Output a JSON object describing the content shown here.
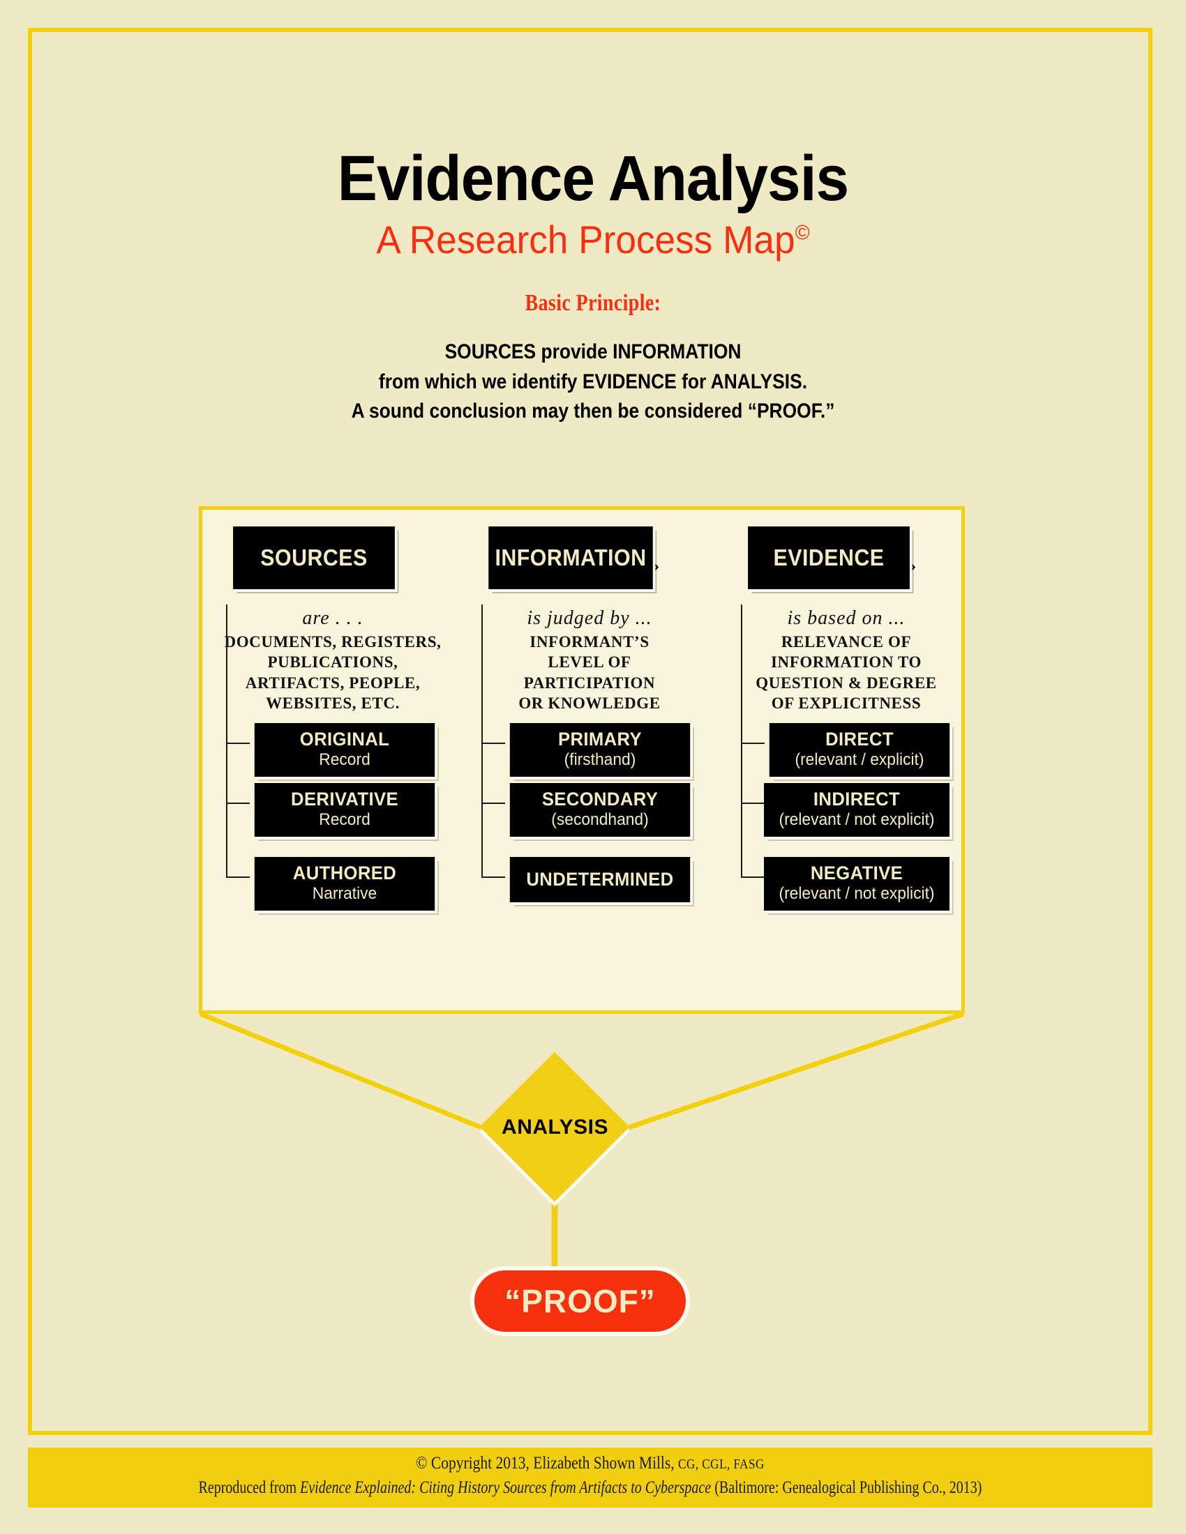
{
  "colors": {
    "page_background": "#efeac4",
    "border_yellow": "#f2d00d",
    "panel_background": "#f9f5dd",
    "accent_red": "#f72f10",
    "proof_red": "#f4300d",
    "box_black": "#000000",
    "box_text_cream": "#f2ecc4",
    "diamond_yellow": "#f2cf17",
    "footer_yellow": "#f2cf0e"
  },
  "header": {
    "title": "Evidence Analysis",
    "subtitle": "A Research Process Map",
    "subtitle_mark": "©",
    "basic_principle_label": "Basic Principle:",
    "principle_lines": [
      "SOURCES provide INFORMATION",
      "from which we identify EVIDENCE for ANALYSIS.",
      "A sound conclusion may then be considered “PROOF.”"
    ]
  },
  "diagram": {
    "arrow_glyph": "⇨",
    "columns": [
      {
        "id": "sources",
        "header": "SOURCES",
        "lead": "are . . .",
        "body_lines": [
          "DOCUMENTS,  REGISTERS,",
          "PUBLICATIONS,",
          "ARTIFACTS,  PEOPLE,",
          "WEBSITES,  ETC."
        ],
        "items": [
          {
            "title": "ORIGINAL",
            "subtitle": "Record"
          },
          {
            "title": "DERIVATIVE",
            "subtitle": "Record"
          },
          {
            "title": "AUTHORED",
            "subtitle": "Narrative"
          }
        ]
      },
      {
        "id": "information",
        "header": "INFORMATION",
        "lead": "is judged by ...",
        "body_lines": [
          "INFORMANT’S",
          "LEVEL OF",
          "PARTICIPATION",
          "OR KNOWLEDGE"
        ],
        "items": [
          {
            "title": "PRIMARY",
            "subtitle": "(firsthand)"
          },
          {
            "title": "SECONDARY",
            "subtitle": "(secondhand)"
          },
          {
            "title": "UNDETERMINED",
            "subtitle": ""
          }
        ]
      },
      {
        "id": "evidence",
        "header": "EVIDENCE",
        "lead": "is based on ...",
        "body_lines": [
          "RELEVANCE OF",
          "INFORMATION TO",
          "QUESTION & DEGREE",
          "OF EXPLICITNESS"
        ],
        "items": [
          {
            "title": "DIRECT",
            "subtitle": "(relevant / explicit)"
          },
          {
            "title": "INDIRECT",
            "subtitle": "(relevant / not explicit)"
          },
          {
            "title": "NEGATIVE",
            "subtitle": "(relevant / not explicit)"
          }
        ]
      }
    ]
  },
  "analysis": {
    "label": "ANALYSIS"
  },
  "proof": {
    "label": "“PROOF”"
  },
  "footer": {
    "line1_main": "© Copyright 2013, Elizabeth Shown Mills, ",
    "line1_credentials": "CG, CGL, FASG",
    "line2_prefix": "Reproduced from ",
    "line2_italic": "Evidence Explained: Citing History Sources from Artifacts to Cyberspace",
    "line2_suffix": " (Baltimore: Genealogical Publishing Co., 2013)"
  }
}
